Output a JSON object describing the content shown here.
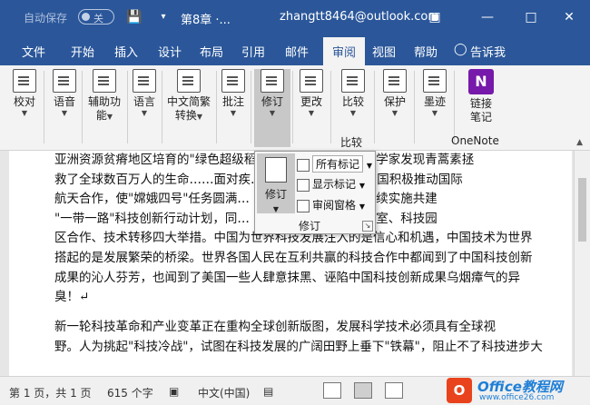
{
  "titlebar": {
    "autosave_label": "自动保存",
    "autosave_state": "关",
    "doc_title": "第8章 ·...",
    "account": "zhangtt8464@outlook.com"
  },
  "tabs": [
    "文件",
    "开始",
    "插入",
    "设计",
    "布局",
    "引用",
    "邮件",
    "审阅",
    "视图",
    "帮助",
    "告诉我"
  ],
  "active_tab": "审阅",
  "ribbon": {
    "buttons": [
      {
        "label1": "校对",
        "label2": ""
      },
      {
        "label1": "语音",
        "label2": ""
      },
      {
        "label1": "辅助功",
        "label2": "能"
      },
      {
        "label1": "语言",
        "label2": ""
      },
      {
        "label1": "中文简繁",
        "label2": "转换"
      },
      {
        "label1": "批注",
        "label2": ""
      },
      {
        "label1": "修订",
        "label2": ""
      },
      {
        "label1": "更改",
        "label2": ""
      },
      {
        "label1": "比较",
        "label2": ""
      },
      {
        "label1": "保护",
        "label2": ""
      },
      {
        "label1": "墨迹",
        "label2": ""
      },
      {
        "label1": "链接",
        "label2": "笔记"
      }
    ],
    "group_compare": "比较",
    "group_onenote": "OneNote",
    "onenote_letter": "N"
  },
  "popup": {
    "big_label": "修订",
    "rows": [
      "所有标记",
      "显示标记",
      "审阅窗格"
    ],
    "group_label": "修订"
  },
  "document": {
    "lines": [
      "亚洲资源贫瘠地区培育的\"绿色超级稻\"…        …种推广，中国科学家发现青蒿素拯",
      "救了全球数百万人的生命……面对疾…        …类的共同梦想，中国积极推动国际",
      "航天合作，使\"嫦娥四号\"任务圆满…        …新篇章。中国承诺继续实施共建",
      "\"一带一路\"科技创新行动计划，同…        …交流、共建联合实验室、科技园",
      "区合作、技术转移四大举措。中国为世界科技发展注入的是信心和机遇，中国技术为世界",
      "搭起的是发展繁荣的桥梁。世界各国人民在互利共赢的科技合作中都闻到了中国科技创新",
      "成果的沁人芬芳，也闻到了美国一些人肆意抹黑、诬陷中国科技创新成果乌烟瘴气的异",
      "臭！↵",
      "",
      "    新一轮科技革命和产业变革正在重构全球创新版图，发展科学技术必须具有全球视",
      "野。人为挑起\"科技冷战\"，试图在科技发展的广阔田野上垂下\"铁幕\"，阻止不了科技进步大"
    ]
  },
  "statusbar": {
    "page": "第 1 页，共 1 页",
    "words": "615 个字",
    "language": "中文(中国)"
  },
  "watermark": {
    "logo": "O",
    "text": "Office教程网",
    "sub": "www.office26.com"
  }
}
